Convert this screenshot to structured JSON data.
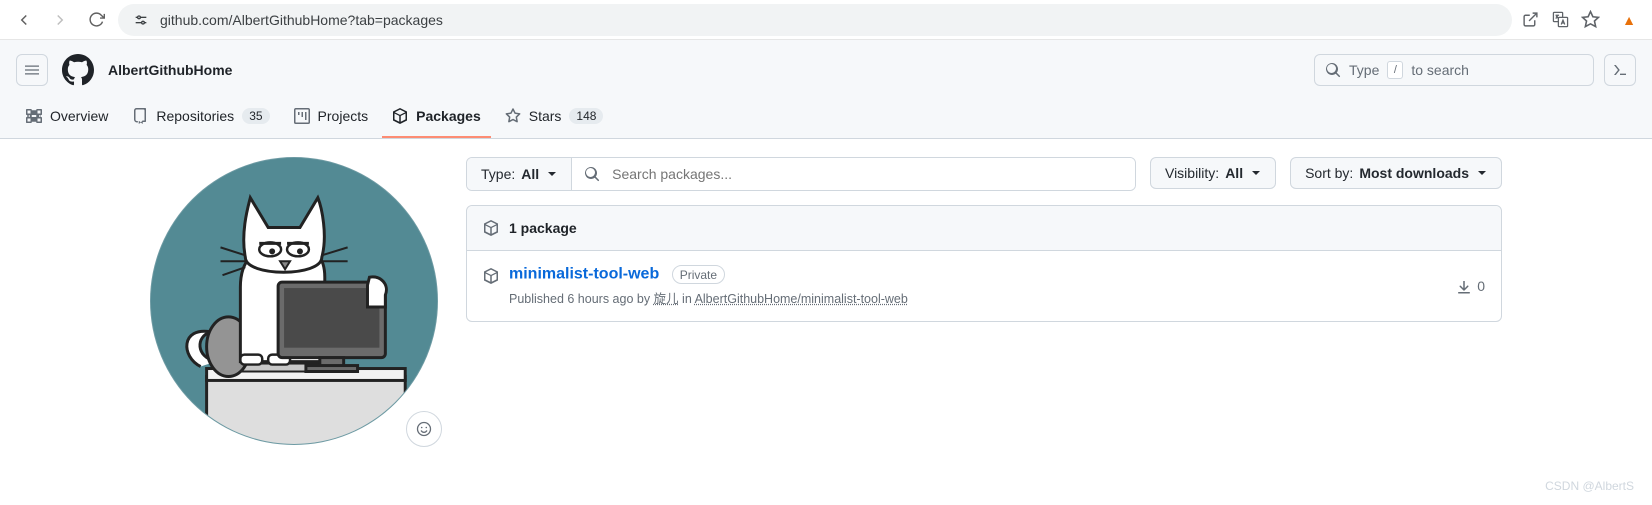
{
  "browser": {
    "url": "github.com/AlbertGithubHome?tab=packages"
  },
  "header": {
    "context_name": "AlbertGithubHome",
    "search_prefix": "Type",
    "search_key": "/",
    "search_suffix": "to search"
  },
  "nav": {
    "overview": "Overview",
    "repositories": "Repositories",
    "repositories_count": "35",
    "projects": "Projects",
    "packages": "Packages",
    "stars": "Stars",
    "stars_count": "148"
  },
  "filters": {
    "type_label": "Type:",
    "type_value": "All",
    "search_placeholder": "Search packages...",
    "visibility_label": "Visibility:",
    "visibility_value": "All",
    "sort_label": "Sort by:",
    "sort_value": "Most downloads"
  },
  "box": {
    "header": "1 package",
    "pkg_name": "minimalist-tool-web",
    "pkg_badge": "Private",
    "meta_prefix": "Published 6 hours ago by ",
    "meta_author": "旋儿",
    "meta_in": " in ",
    "meta_repo": "AlbertGithubHome/minimalist-tool-web",
    "downloads": "0"
  },
  "watermark": "CSDN @AlbertS"
}
